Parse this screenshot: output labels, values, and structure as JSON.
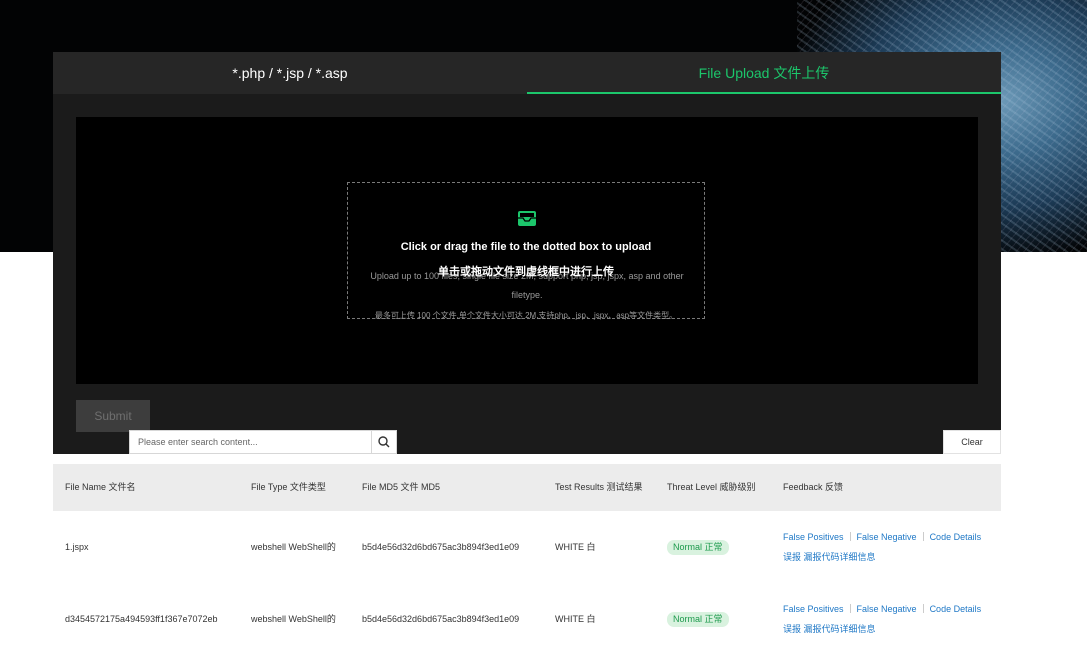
{
  "tabs": [
    {
      "label": "*.php / *.jsp / *.asp"
    },
    {
      "label": "File Upload 文件上传"
    }
  ],
  "upload": {
    "title": "Click or drag the file to the dotted box to upload",
    "subtitle_cn": "单击或拖动文件到虚线框中进行上传",
    "subtitle_en": "Upload up to 100 files, single file size 2M, support php, jsp, jspx, asp and other filetype.",
    "note_cn": "最多可上传 100 个文件,单个文件大小可达 2M,支持php、jsp、jspx、asp等文件类型。",
    "icon": "inbox-tray-icon",
    "accent_color": "#1cc66b"
  },
  "submit_label": "Submit",
  "search": {
    "placeholder": "Please enter search content...",
    "icon": "search-icon"
  },
  "clear_label": "Clear",
  "table": {
    "headers": {
      "file_name": "File Name 文件名",
      "file_type": "File Type 文件类型",
      "md5": "File MD5 文件 MD5",
      "results": "Test Results 测试结果",
      "threat": "Threat Level 威胁级别",
      "feedback": "Feedback 反馈"
    },
    "rows": [
      {
        "file_name": "1.jspx",
        "file_type": "webshell WebShell的",
        "md5": "b5d4e56d32d6bd675ac3b894f3ed1e09",
        "result": "WHITE 白",
        "threat": "Normal 正常",
        "fb_false_pos": "False Positives",
        "fb_false_neg": "False Negative",
        "fb_code": "Code Details",
        "fb_cn": "误报 漏报代码详细信息"
      },
      {
        "file_name": "d3454572175a494593ff1f367e7072eb",
        "file_type": "webshell WebShell的",
        "md5": "b5d4e56d32d6bd675ac3b894f3ed1e09",
        "result": "WHITE 白",
        "threat": "Normal 正常",
        "fb_false_pos": "False Positives",
        "fb_false_neg": "False Negative",
        "fb_code": "Code Details",
        "fb_cn": "误报 漏报代码详细信息"
      }
    ]
  }
}
